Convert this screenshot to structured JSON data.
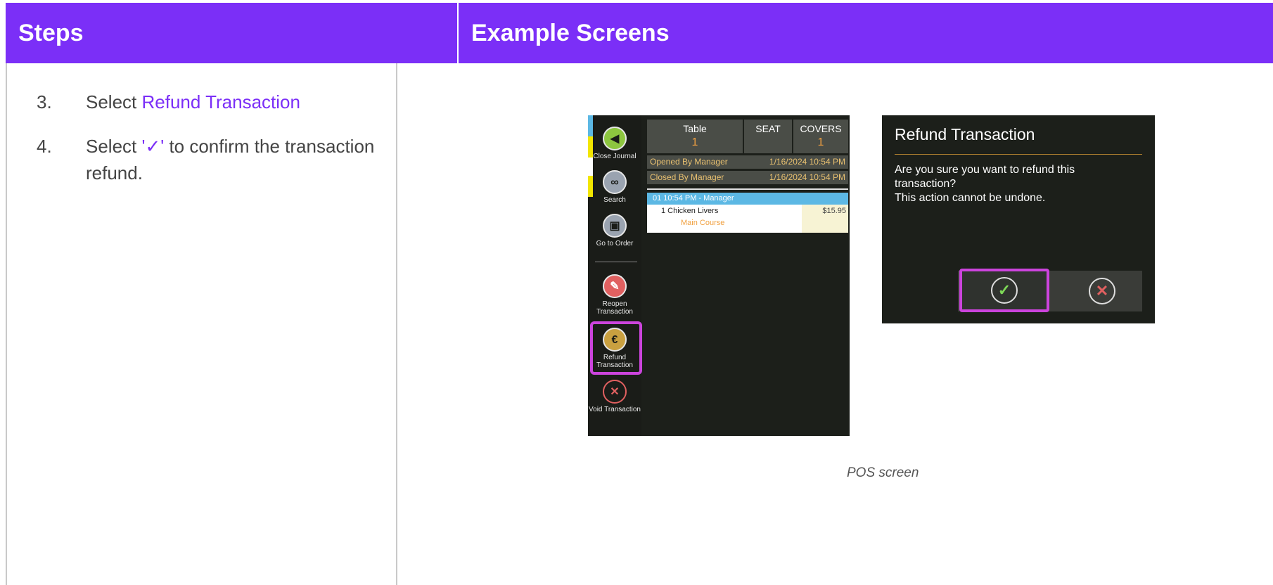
{
  "header": {
    "steps": "Steps",
    "examples": "Example Screens"
  },
  "steps": [
    {
      "num": "3.",
      "prefix": "Select ",
      "link": "Refund Transaction",
      "suffix": ""
    },
    {
      "num": "4.",
      "prefix": "Select ",
      "link": "'✓'",
      "suffix": " to confirm the transaction refund."
    }
  ],
  "pos_journal": {
    "sidebar": [
      {
        "label": "Close Journal",
        "icon": "back-arrow-icon"
      },
      {
        "label": "Search",
        "icon": "binoculars-icon"
      },
      {
        "label": "Go to Order",
        "icon": "order-icon"
      },
      {
        "label": "Reopen Transaction",
        "icon": "eraser-icon"
      },
      {
        "label": "Refund Transaction",
        "icon": "refund-icon"
      },
      {
        "label": "Void Transaction",
        "icon": "void-x-icon"
      }
    ],
    "table": {
      "label": "Table",
      "value": "1"
    },
    "seat": {
      "label": "SEAT"
    },
    "covers": {
      "label": "COVERS",
      "value": "1"
    },
    "opened": {
      "label": "Opened By Manager",
      "time": "1/16/2024 10:54 PM"
    },
    "closed": {
      "label": "Closed By Manager",
      "time": "1/16/2024 10:54 PM"
    },
    "item_header": "01  10:54 PM - Manager",
    "item": {
      "name": "1  Chicken Livers",
      "price": "$15.95",
      "course": "Main Course"
    }
  },
  "dialog": {
    "title": "Refund Transaction",
    "message": "Are you sure you want to refund this\ntransaction?\nThis action cannot be undone.",
    "confirm_glyph": "✓",
    "cancel_glyph": "✕"
  },
  "caption": "POS screen",
  "colors": {
    "accent": "#7b2ff7",
    "highlight": "#cc44dd"
  }
}
